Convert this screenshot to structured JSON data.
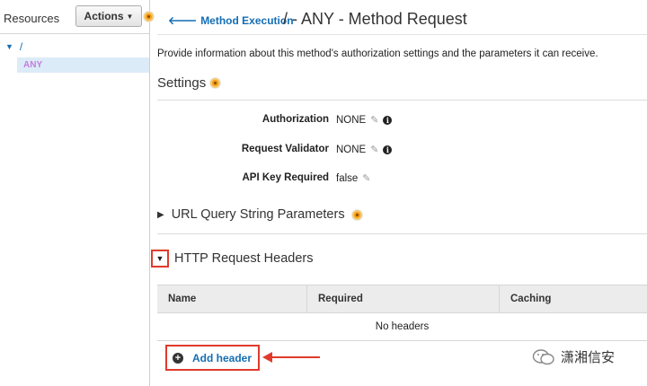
{
  "sidebar": {
    "title": "Resources",
    "actions_label": "Actions",
    "tree": {
      "root_label": "/",
      "method_label": "ANY"
    }
  },
  "header": {
    "back_link": "Method Execution",
    "title": "/ - ANY - Method Request"
  },
  "description": "Provide information about this method's authorization settings and the parameters it can receive.",
  "settings": {
    "title": "Settings",
    "fields": [
      {
        "label": "Authorization",
        "value": "NONE"
      },
      {
        "label": "Request Validator",
        "value": "NONE"
      },
      {
        "label": "API Key Required",
        "value": "false"
      }
    ]
  },
  "url_query": {
    "title": "URL Query String Parameters"
  },
  "http_headers": {
    "title": "HTTP Request Headers",
    "columns": [
      "Name",
      "Required",
      "Caching"
    ],
    "empty_message": "No headers",
    "add_label": "Add header"
  },
  "watermark": {
    "text": "潇湘信安"
  },
  "colors": {
    "link": "#146eb4",
    "highlight_red": "#e03a2b",
    "info_orange": "#f39c12",
    "selected_bg": "#dcebf8"
  }
}
